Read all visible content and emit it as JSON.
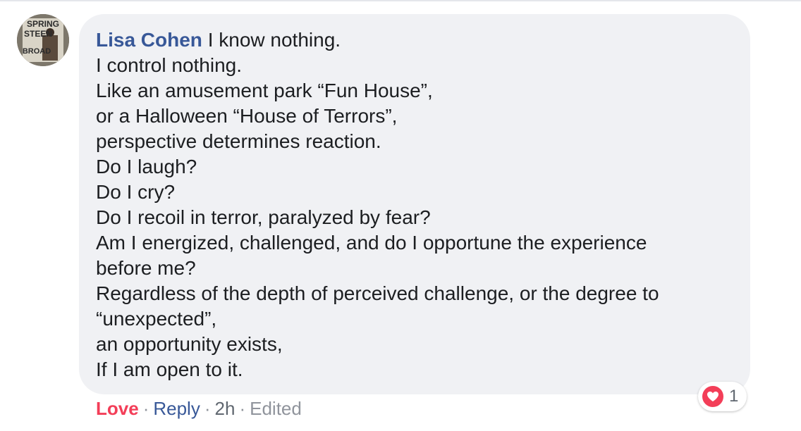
{
  "comment": {
    "author": "Lisa Cohen",
    "first_line": " I know nothing.",
    "lines": [
      "I control nothing.",
      "Like an amusement park “Fun House”,",
      "or a Halloween “House of Terrors”,",
      "perspective determines reaction.",
      "Do I laugh?",
      "Do I cry?",
      "Do I recoil in terror, paralyzed by fear?",
      "Am I energized, challenged, and do I opportune the experience",
      "before me?",
      "Regardless of the depth of perceived challenge, or the degree to",
      "“unexpected”,",
      "an opportunity exists,",
      "If I am open to it."
    ]
  },
  "avatar": {
    "text_lines": [
      "SPRING",
      "STEEN",
      "BROAD"
    ]
  },
  "reactions": {
    "icon": "heart-icon",
    "count": "1",
    "color": "#f33e58"
  },
  "actions": {
    "love": "Love",
    "reply": "Reply",
    "separator": "·",
    "time": "2h",
    "edited": "Edited"
  },
  "colors": {
    "author": "#385898",
    "bubble": "#f0f1f4",
    "love": "#f33e58",
    "meta": "#606770"
  }
}
